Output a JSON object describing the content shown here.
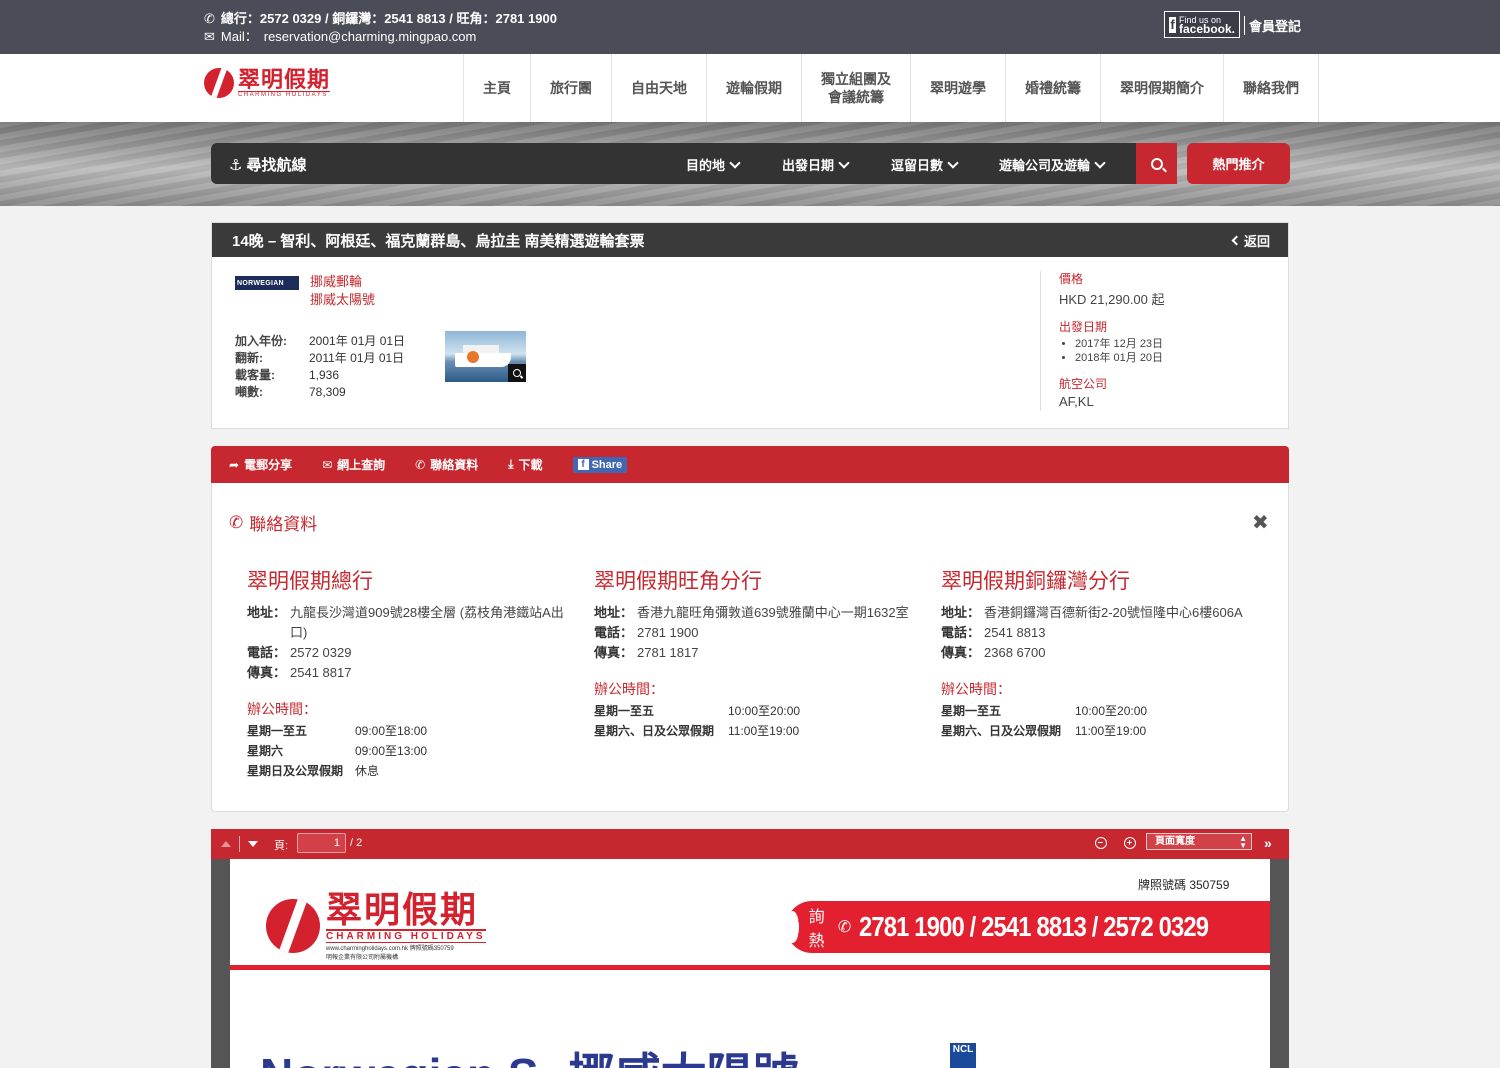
{
  "topbar": {
    "phones": "總行：2572 0329 / 銅鑼灣：2541 8813 / 旺角：2781 1900",
    "mail_label": "Mail：",
    "mail": "reservation@charming.mingpao.com",
    "fb_small": "Find us on",
    "fb_big": "facebook.",
    "member": "會員登記"
  },
  "header": {
    "logo_zh": "翠明假期",
    "logo_en": "CHARMING HOLIDAYS",
    "nav": [
      {
        "label": "主頁"
      },
      {
        "label": "旅行團"
      },
      {
        "label": "自由天地"
      },
      {
        "label": "遊輪假期"
      },
      {
        "label": "獨立組團及\n會議統籌"
      },
      {
        "label": "翠明遊學"
      },
      {
        "label": "婚禮統籌"
      },
      {
        "label": "翠明假期簡介"
      },
      {
        "label": "聯絡我們"
      }
    ]
  },
  "search": {
    "label": "尋找航線",
    "dropdowns": [
      "目的地",
      "出發日期",
      "逗留日數",
      "遊輪公司及遊輪"
    ],
    "hot": "熱門推介"
  },
  "detail": {
    "title": "14晚 – 智利、阿根廷、福克蘭群島、烏拉圭 南美精選遊輪套票",
    "back": "返回",
    "cruise_logo": "NORWEGIAN",
    "cruise_line": "挪威郵輪",
    "ship": "挪威太陽號",
    "specs": [
      {
        "k": "加入年份:",
        "v": "2001年 01月 01日"
      },
      {
        "k": "翻新:",
        "v": "2011年 01月 01日"
      },
      {
        "k": "載客量:",
        "v": "1,936"
      },
      {
        "k": "噸數:",
        "v": "78,309"
      }
    ],
    "price_label": "價格",
    "price": "HKD 21,290.00 起",
    "dates_label": "出發日期",
    "dates": [
      "2017年 12月 23日",
      "2018年 01月 20日"
    ],
    "airline_label": "航空公司",
    "airline": "AF,KL"
  },
  "actions": {
    "email": "電郵分享",
    "enquiry": "網上查詢",
    "contact": "聯絡資料",
    "download": "下載",
    "share": "Share"
  },
  "contact": {
    "title": "聯絡資料",
    "close": "✖",
    "branches": [
      {
        "name": "翠明假期總行",
        "lines": [
          {
            "k": "地址：",
            "v": "九龍長沙灣道909號28樓全層 (荔枝角港鐵站A出口)"
          },
          {
            "k": "電話：",
            "v": "2572 0329"
          },
          {
            "k": "傳真：",
            "v": "2541 8817"
          }
        ],
        "hours_label": "辦公時間：",
        "hours": [
          {
            "d": "星期一至五",
            "t": "09:00至18:00"
          },
          {
            "d": "星期六",
            "t": "09:00至13:00"
          },
          {
            "d": "星期日及公眾假期",
            "t": "休息"
          }
        ]
      },
      {
        "name": "翠明假期旺角分行",
        "lines": [
          {
            "k": "地址：",
            "v": "香港九龍旺角彌敦道639號雅蘭中心一期1632室"
          },
          {
            "k": "電話：",
            "v": "2781 1900"
          },
          {
            "k": "傳真：",
            "v": "2781 1817"
          }
        ],
        "hours_label": "辦公時間：",
        "hours": [
          {
            "d": "星期一至五",
            "t": "10:00至20:00"
          },
          {
            "d": "星期六、日及公眾假期",
            "t": "11:00至19:00"
          }
        ]
      },
      {
        "name": "翠明假期銅鑼灣分行",
        "lines": [
          {
            "k": "地址：",
            "v": "香港銅鑼灣百德新街2-20號恒隆中心6樓606A"
          },
          {
            "k": "電話：",
            "v": "2541 8813"
          },
          {
            "k": "傳真：",
            "v": "2368 6700"
          }
        ],
        "hours_label": "辦公時間：",
        "hours": [
          {
            "d": "星期一至五",
            "t": "10:00至20:00"
          },
          {
            "d": "星期六、日及公眾假期",
            "t": "11:00至19:00"
          }
        ]
      }
    ]
  },
  "pdf": {
    "page_label": "頁:",
    "page_value": "1",
    "page_total": "/ 2",
    "zoom": "頁面寬度",
    "licence": "牌照號碼 350759",
    "hotline_label": "查詢熱線",
    "hotline": "2781 1900 / 2541 8813 / 2572 0329",
    "logo_zh": "翠明假期",
    "logo_en": "CHARMING HOLIDAYS",
    "logo_sub": "www.charmingholidays.com.hk  牌照號碼350759",
    "logo_sub2": "明報企業有限公司附屬機構",
    "headline_en": "Norwegian S",
    "headline_zh": "挪威太陽號",
    "ncl": "NCL"
  },
  "colors": {
    "accent": "#c7282f",
    "dark": "#3a3a3a",
    "topbar": "#4a4d58"
  }
}
